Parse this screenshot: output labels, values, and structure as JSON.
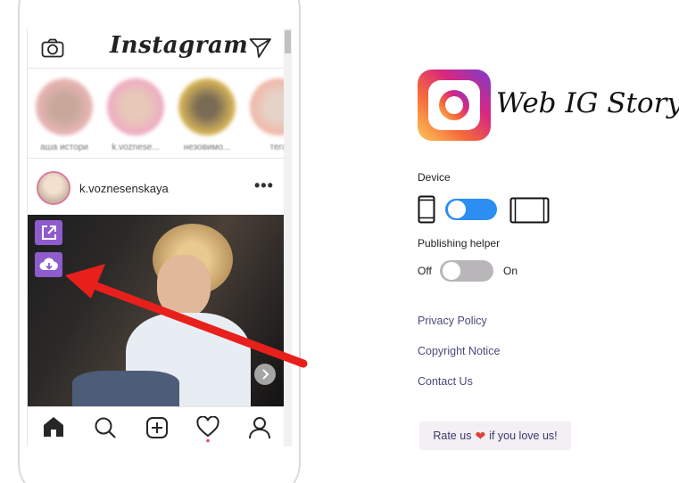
{
  "phone": {
    "app_title": "Instagram",
    "stories": [
      {
        "name": "аша истори"
      },
      {
        "name": "k.voznesе..."
      },
      {
        "name": "незовимо..."
      },
      {
        "name": "тега"
      }
    ],
    "post": {
      "username": "k.voznesenskaya",
      "more": "•••"
    }
  },
  "panel": {
    "brand_title": "Web IG Story",
    "device_label": "Device",
    "publishing_label": "Publishing helper",
    "off_label": "Off",
    "on_label": "On",
    "device_toggle_state": "phone",
    "publishing_toggle_state": "off",
    "links": [
      {
        "label": "Privacy Policy"
      },
      {
        "label": "Copyright Notice"
      },
      {
        "label": "Contact Us"
      }
    ],
    "rate": {
      "before": "Rate us",
      "heart": "❤",
      "after": "if you love us!"
    }
  },
  "colors": {
    "accent_blue": "#2b8ef0",
    "button_purple": "#8e5ccc",
    "arrow_red": "#e8201c"
  }
}
